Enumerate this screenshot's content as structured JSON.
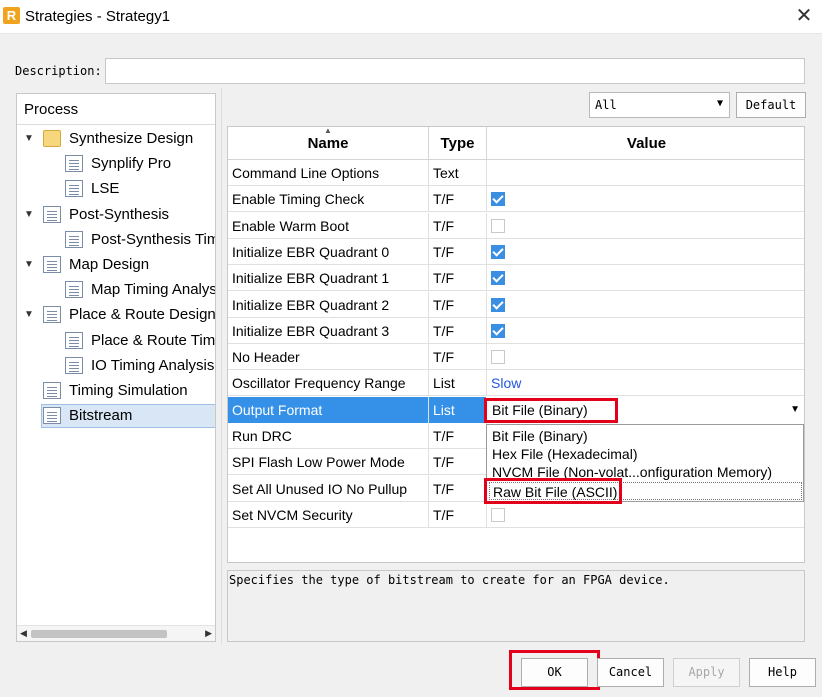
{
  "window": {
    "title": "Strategies - Strategy1",
    "app_icon": "R"
  },
  "description": {
    "label": "Description:",
    "value": ""
  },
  "process_panel": {
    "header": "Process",
    "tree": [
      {
        "label": "Synthesize Design",
        "icon": "folder-icon",
        "expanded": true,
        "level": 0
      },
      {
        "label": "Synplify Pro",
        "icon": "document-icon",
        "level": 1
      },
      {
        "label": "LSE",
        "icon": "document-icon",
        "level": 1
      },
      {
        "label": "Post-Synthesis",
        "icon": "document-icon",
        "expanded": true,
        "level": 0
      },
      {
        "label": "Post-Synthesis Tim",
        "icon": "document-icon",
        "level": 1
      },
      {
        "label": "Map Design",
        "icon": "document-icon",
        "expanded": true,
        "level": 0
      },
      {
        "label": "Map Timing Analys",
        "icon": "document-icon",
        "level": 1
      },
      {
        "label": "Place & Route Design",
        "icon": "document-icon",
        "expanded": true,
        "level": 0
      },
      {
        "label": "Place & Route Tim",
        "icon": "document-icon",
        "level": 1
      },
      {
        "label": "IO Timing Analysis",
        "icon": "document-icon",
        "level": 1
      },
      {
        "label": "Timing Simulation",
        "icon": "document-icon",
        "level": 0
      },
      {
        "label": "Bitstream",
        "icon": "document-icon",
        "level": 0,
        "selected": true
      }
    ]
  },
  "filter": {
    "value": "All",
    "default_button": "Default"
  },
  "grid": {
    "headers": {
      "name": "Name",
      "type": "Type",
      "value": "Value"
    },
    "rows": [
      {
        "name": "Command Line Options",
        "type": "Text",
        "kind": "text",
        "value": ""
      },
      {
        "name": "Enable Timing Check",
        "type": "T/F",
        "kind": "check",
        "checked": true
      },
      {
        "name": "Enable Warm Boot",
        "type": "T/F",
        "kind": "check",
        "checked": false
      },
      {
        "name": "Initialize EBR Quadrant 0",
        "type": "T/F",
        "kind": "check",
        "checked": true
      },
      {
        "name": "Initialize EBR Quadrant 1",
        "type": "T/F",
        "kind": "check",
        "checked": true
      },
      {
        "name": "Initialize EBR Quadrant 2",
        "type": "T/F",
        "kind": "check",
        "checked": true
      },
      {
        "name": "Initialize EBR Quadrant 3",
        "type": "T/F",
        "kind": "check",
        "checked": true
      },
      {
        "name": "No Header",
        "type": "T/F",
        "kind": "check",
        "checked": false
      },
      {
        "name": "Oscillator Frequency Range",
        "type": "List",
        "kind": "link",
        "value": "Slow"
      },
      {
        "name": "Output Format",
        "type": "List",
        "kind": "combo",
        "value": "Bit File (Binary)",
        "selected": true
      },
      {
        "name": "Run DRC",
        "type": "T/F",
        "kind": "hidden"
      },
      {
        "name": "SPI Flash Low Power Mode",
        "type": "T/F",
        "kind": "hidden"
      },
      {
        "name": "Set All Unused IO No Pullup",
        "type": "T/F",
        "kind": "hidden"
      },
      {
        "name": "Set NVCM Security",
        "type": "T/F",
        "kind": "check",
        "checked": false
      }
    ]
  },
  "dropdown_options": [
    "Bit File (Binary)",
    "Hex File (Hexadecimal)",
    "NVCM File (Non-volat...onfiguration Memory)",
    "Raw Bit File (ASCII)"
  ],
  "info_text": "Specifies the type of bitstream to create for an FPGA device.",
  "buttons": {
    "ok": "OK",
    "cancel": "Cancel",
    "apply": "Apply",
    "help": "Help"
  },
  "colors": {
    "selection": "#3591e8",
    "highlight_box": "#e2001a",
    "checkbox": "#3b8fe2",
    "link": "#2255dd"
  }
}
